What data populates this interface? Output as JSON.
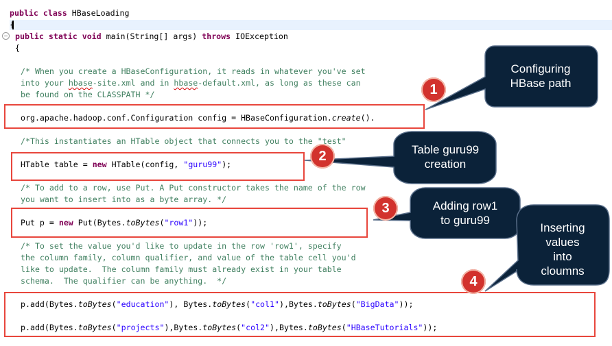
{
  "code": {
    "class_decl": {
      "kw": "public class",
      "name": " HBaseLoading"
    },
    "open_brace": "{",
    "main_sig": {
      "kw1": "public static void",
      "mid": " main(String[] args) ",
      "kw2": "throws",
      "tail": " IOException"
    },
    "main_brace": "{",
    "comment1": [
      "/* When you create a HBaseConfiguration, it reads in whatever you've set",
      "into your ",
      "hbase",
      "-site.xml and in ",
      "hbase",
      "-default.xml, as long as these can",
      "be found on the CLASSPATH */"
    ],
    "config_line": {
      "a": "org.apache.hadoop.conf.Configuration config = HBaseConfiguration.",
      "b": "create",
      "c": "()."
    },
    "comment2": "/*This instantiates an HTable object that connects you to the \"test\"",
    "htable_line": {
      "a": "HTable table = ",
      "kw": "new",
      "b": " HTable(config, ",
      "str": "\"guru99\"",
      "c": ");"
    },
    "comment3": [
      "/* To add to a row, use Put. A Put constructor takes the name of the row",
      "you want to insert into as a byte array. */"
    ],
    "put_line": {
      "a": "Put p = ",
      "kw": "new",
      "b": " Put(Bytes.",
      "fn": "toBytes",
      "c": "(",
      "str": "\"row1\"",
      "d": "));"
    },
    "comment4": [
      "/* To set the value you'd like to update in the row 'row1', specify",
      "the column family, column qualifier, and value of the table cell you'd",
      "like to update.  The column family must already exist in your table",
      "schema.  The qualifier can be anything.  */"
    ],
    "add1": {
      "a": "p.add(Bytes.",
      "fn1": "toBytes",
      "b": "(",
      "s1": "\"education\"",
      "c": "), Bytes.",
      "fn2": "toBytes",
      "d": "(",
      "s2": "\"col1\"",
      "e": "),Bytes.",
      "fn3": "toBytes",
      "f": "(",
      "s3": "\"BigData\"",
      "g": "));"
    },
    "add2": {
      "a": "p.add(Bytes.",
      "fn1": "toBytes",
      "b": "(",
      "s1": "\"projects\"",
      "c": "),Bytes.",
      "fn2": "toBytes",
      "d": "(",
      "s2": "\"col2\"",
      "e": "),Bytes.",
      "fn3": "toBytes",
      "f": "(",
      "s3": "\"HBaseTutorials\"",
      "g": "));"
    }
  },
  "annotations": {
    "badges": [
      "1",
      "2",
      "3",
      "4"
    ],
    "callouts": [
      [
        "Configuring",
        "HBase path"
      ],
      [
        "Table guru99",
        "creation"
      ],
      [
        "Adding row1",
        "to guru99"
      ],
      [
        "Inserting",
        "values",
        "into",
        "cloumns"
      ]
    ]
  },
  "colors": {
    "keyword": "#7f0055",
    "comment": "#3f7f5f",
    "string": "#2a00ff",
    "highlight_box": "#e8463c",
    "badge": "#d2322d",
    "callout": "#0b2239"
  }
}
